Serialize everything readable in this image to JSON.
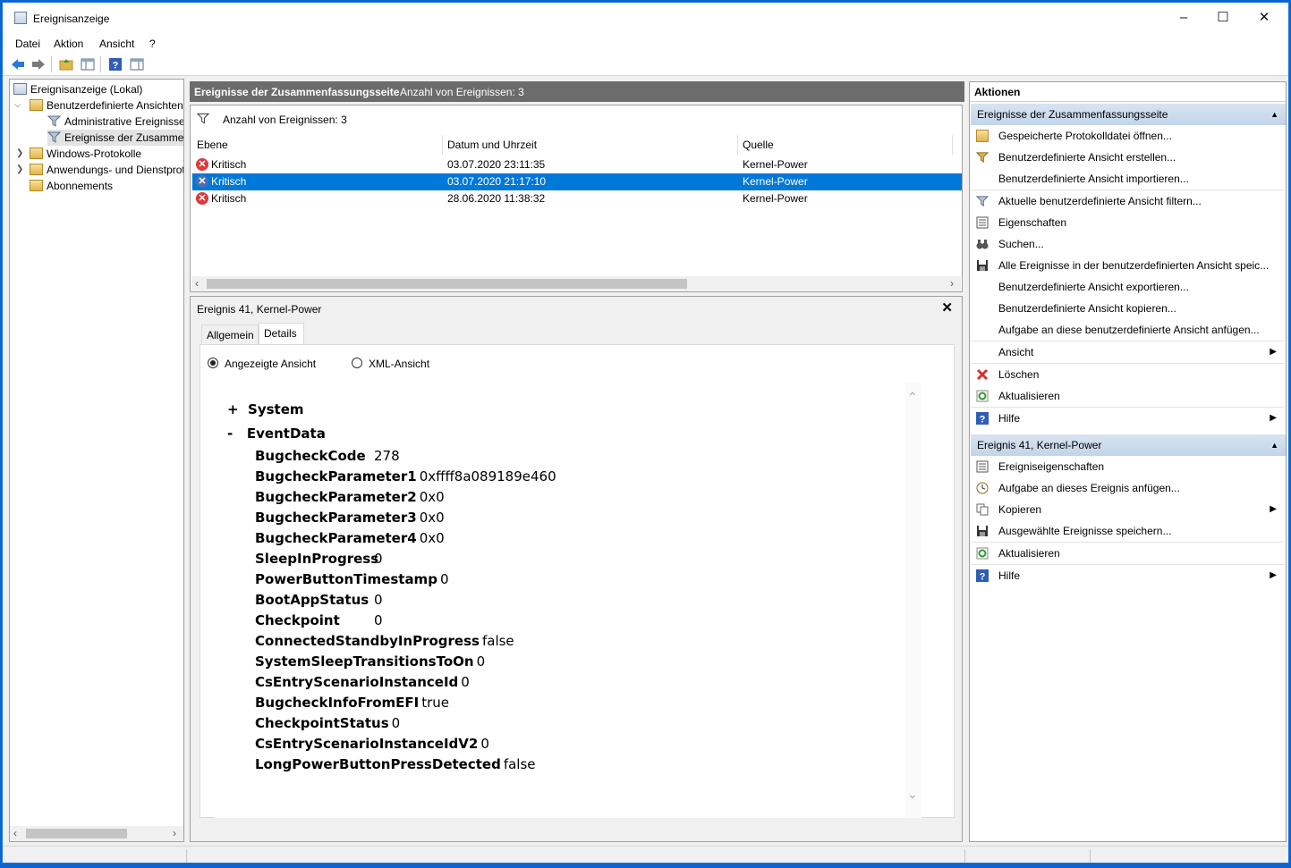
{
  "window": {
    "title": "Ereignisanzeige"
  },
  "menu": [
    "Datei",
    "Aktion",
    "Ansicht",
    "?"
  ],
  "tree": {
    "root": "Ereignisanzeige (Lokal)",
    "custom_views": "Benutzerdefinierte Ansichten",
    "admin_events": "Administrative Ereignisse",
    "summary_events": "Ereignisse der Zusammenfassungsseite",
    "windows_logs": "Windows-Protokolle",
    "app_logs": "Anwendungs- und Dienstprotokolle",
    "subscriptions": "Abonnements"
  },
  "center": {
    "header_title": "Ereignisse der Zusammenfassungsseite",
    "header_count": "Anzahl von Ereignissen: 3",
    "filter_text": "Anzahl von Ereignissen: 3",
    "columns": [
      "Ebene",
      "Datum und Uhrzeit",
      "Quelle"
    ],
    "rows": [
      {
        "level": "Kritisch",
        "datetime": "03.07.2020 23:11:35",
        "source": "Kernel-Power"
      },
      {
        "level": "Kritisch",
        "datetime": "03.07.2020 21:17:10",
        "source": "Kernel-Power"
      },
      {
        "level": "Kritisch",
        "datetime": "28.06.2020 11:38:32",
        "source": "Kernel-Power"
      }
    ]
  },
  "detail": {
    "title": "Ereignis 41, Kernel-Power",
    "tabs": [
      "Allgemein",
      "Details"
    ],
    "radio_friendly": "Angezeigte Ansicht",
    "radio_xml": "XML-Ansicht",
    "system_label": "System",
    "system_toggle": "+",
    "eventdata_label": "EventData",
    "eventdata_toggle": "-",
    "fields": [
      {
        "name": "BugcheckCode",
        "value": "278"
      },
      {
        "name": "BugcheckParameter1",
        "value": "0xffff8a089189e460"
      },
      {
        "name": "BugcheckParameter2",
        "value": "0x0"
      },
      {
        "name": "BugcheckParameter3",
        "value": "0x0"
      },
      {
        "name": "BugcheckParameter4",
        "value": "0x0"
      },
      {
        "name": "SleepInProgress",
        "value": "0"
      },
      {
        "name": "PowerButtonTimestamp",
        "value": "0"
      },
      {
        "name": "BootAppStatus",
        "value": "0"
      },
      {
        "name": "Checkpoint",
        "value": "0"
      },
      {
        "name": "ConnectedStandbyInProgress",
        "value": "false"
      },
      {
        "name": "SystemSleepTransitionsToOn",
        "value": "0"
      },
      {
        "name": "CsEntryScenarioInstanceId",
        "value": "0"
      },
      {
        "name": "BugcheckInfoFromEFI",
        "value": "true"
      },
      {
        "name": "CheckpointStatus",
        "value": "0"
      },
      {
        "name": "CsEntryScenarioInstanceIdV2",
        "value": "0"
      },
      {
        "name": "LongPowerButtonPressDetected",
        "value": "false"
      }
    ]
  },
  "actions": {
    "header": "Aktionen",
    "group1": "Ereignisse der Zusammenfassungsseite",
    "g1": [
      "Gespeicherte Protokolldatei öffnen...",
      "Benutzerdefinierte Ansicht erstellen...",
      "Benutzerdefinierte Ansicht importieren...",
      "Aktuelle benutzerdefinierte Ansicht filtern...",
      "Eigenschaften",
      "Suchen...",
      "Alle Ereignisse in der benutzerdefinierten Ansicht speic...",
      "Benutzerdefinierte Ansicht exportieren...",
      "Benutzerdefinierte Ansicht kopieren...",
      "Aufgabe an diese benutzerdefinierte Ansicht anfügen...",
      "Ansicht",
      "Löschen",
      "Aktualisieren",
      "Hilfe"
    ],
    "group2": "Ereignis 41, Kernel-Power",
    "g2": [
      "Ereigniseigenschaften",
      "Aufgabe an dieses Ereignis anfügen...",
      "Kopieren",
      "Ausgewählte Ereignisse speichern...",
      "Aktualisieren",
      "Hilfe"
    ]
  }
}
